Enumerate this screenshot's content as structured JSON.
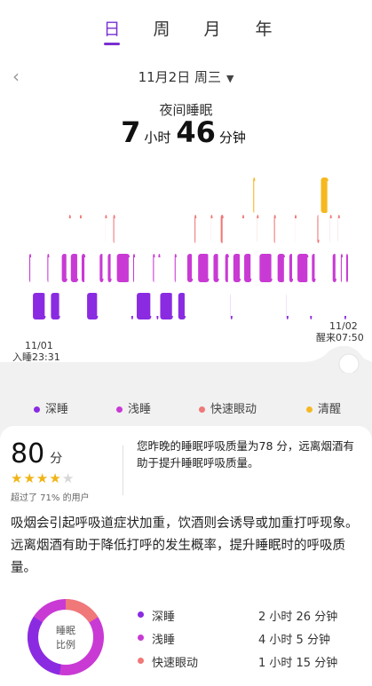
{
  "tabs": [
    "日",
    "周",
    "月",
    "年"
  ],
  "active_tab": 0,
  "date": "11月2日 周三",
  "title": "夜间睡眠",
  "duration": {
    "hours": "7",
    "hours_unit": "小时",
    "minutes": "46",
    "minutes_unit": "分钟"
  },
  "chart_start": {
    "date": "11/01",
    "label": "入睡23:31"
  },
  "chart_end": {
    "date": "11/02",
    "label": "醒来07:50"
  },
  "legend": [
    {
      "label": "深睡",
      "color": "#8a2be2"
    },
    {
      "label": "浅睡",
      "color": "#c93ad4"
    },
    {
      "label": "快速眼动",
      "color": "#f07878"
    },
    {
      "label": "清醒",
      "color": "#f5b820"
    }
  ],
  "score": {
    "value": "80",
    "unit": "分",
    "stars": 4,
    "max_stars": 5,
    "percentile_text": "超过了 71% 的用户"
  },
  "advice_short": "您昨晚的睡眠呼吸质量为78 分，远离烟酒有助于提升睡眠呼吸质量。",
  "advice_long": "吸烟会引起呼吸道症状加重，饮酒则会诱导或加重打呼现象。远离烟酒有助于降低打呼的发生概率，提升睡眠时的呼吸质量。",
  "ratio_label": "睡眠\n比例",
  "ratio_label_1": "睡眠",
  "ratio_label_2": "比例",
  "stats": [
    {
      "label": "深睡",
      "value": "2 小时 26 分钟",
      "color": "#8a2be2",
      "minutes": 146
    },
    {
      "label": "浅睡",
      "value": "4 小时 5 分钟",
      "color": "#c93ad4",
      "minutes": 245
    },
    {
      "label": "快速眼动",
      "value": "1 小时 15 分钟",
      "color": "#f07878",
      "minutes": 75
    }
  ],
  "chart_data": {
    "type": "bar",
    "stages": [
      "深睡",
      "浅睡",
      "快速眼动",
      "清醒"
    ],
    "sequence": [
      {
        "stage": "浅睡",
        "minutes": 4
      },
      {
        "stage": "深睡",
        "minutes": 16
      },
      {
        "stage": "浅睡",
        "minutes": 4
      },
      {
        "stage": "深睡",
        "minutes": 12
      },
      {
        "stage": "浅睡",
        "minutes": 8
      },
      {
        "stage": "快速眼动",
        "minutes": 2
      },
      {
        "stage": "浅睡",
        "minutes": 10
      },
      {
        "stage": "快速眼动",
        "minutes": 2
      },
      {
        "stage": "浅睡",
        "minutes": 6
      },
      {
        "stage": "深睡",
        "minutes": 14
      },
      {
        "stage": "浅睡",
        "minutes": 6
      },
      {
        "stage": "快速眼动",
        "minutes": 3
      },
      {
        "stage": "浅睡",
        "minutes": 6
      },
      {
        "stage": "快速眼动",
        "minutes": 4
      },
      {
        "stage": "浅睡",
        "minutes": 16
      },
      {
        "stage": "深睡",
        "minutes": 2
      },
      {
        "stage": "浅睡",
        "minutes": 4
      },
      {
        "stage": "深睡",
        "minutes": 18
      },
      {
        "stage": "浅睡",
        "minutes": 4
      },
      {
        "stage": "深睡",
        "minutes": 2
      },
      {
        "stage": "浅睡",
        "minutes": 2
      },
      {
        "stage": "深睡",
        "minutes": 16
      },
      {
        "stage": "浅睡",
        "minutes": 4
      },
      {
        "stage": "深睡",
        "minutes": 10
      },
      {
        "stage": "浅睡",
        "minutes": 8
      },
      {
        "stage": "快速眼动",
        "minutes": 4
      },
      {
        "stage": "浅睡",
        "minutes": 14
      },
      {
        "stage": "快速眼动",
        "minutes": 3
      },
      {
        "stage": "浅睡",
        "minutes": 8
      },
      {
        "stage": "快速眼动",
        "minutes": 5
      },
      {
        "stage": "浅睡",
        "minutes": 6
      },
      {
        "stage": "深睡",
        "minutes": 3
      },
      {
        "stage": "浅睡",
        "minutes": 10
      },
      {
        "stage": "快速眼动",
        "minutes": 2
      },
      {
        "stage": "浅睡",
        "minutes": 10
      },
      {
        "stage": "清醒",
        "minutes": 4
      },
      {
        "stage": "快速眼动",
        "minutes": 3
      },
      {
        "stage": "浅睡",
        "minutes": 16
      },
      {
        "stage": "快速眼动",
        "minutes": 4
      },
      {
        "stage": "浅睡",
        "minutes": 10
      },
      {
        "stage": "深睡",
        "minutes": 3
      },
      {
        "stage": "浅睡",
        "minutes": 6
      },
      {
        "stage": "快速眼动",
        "minutes": 3
      },
      {
        "stage": "浅睡",
        "minutes": 14
      },
      {
        "stage": "深睡",
        "minutes": 2
      },
      {
        "stage": "浅睡",
        "minutes": 6
      },
      {
        "stage": "快速眼动",
        "minutes": 4
      },
      {
        "stage": "清醒",
        "minutes": 10
      },
      {
        "stage": "快速眼动",
        "minutes": 3
      },
      {
        "stage": "浅睡",
        "minutes": 6
      },
      {
        "stage": "快速眼动",
        "minutes": 3
      },
      {
        "stage": "浅睡",
        "minutes": 4
      },
      {
        "stage": "深睡",
        "minutes": 2
      },
      {
        "stage": "浅睡",
        "minutes": 2
      }
    ]
  }
}
